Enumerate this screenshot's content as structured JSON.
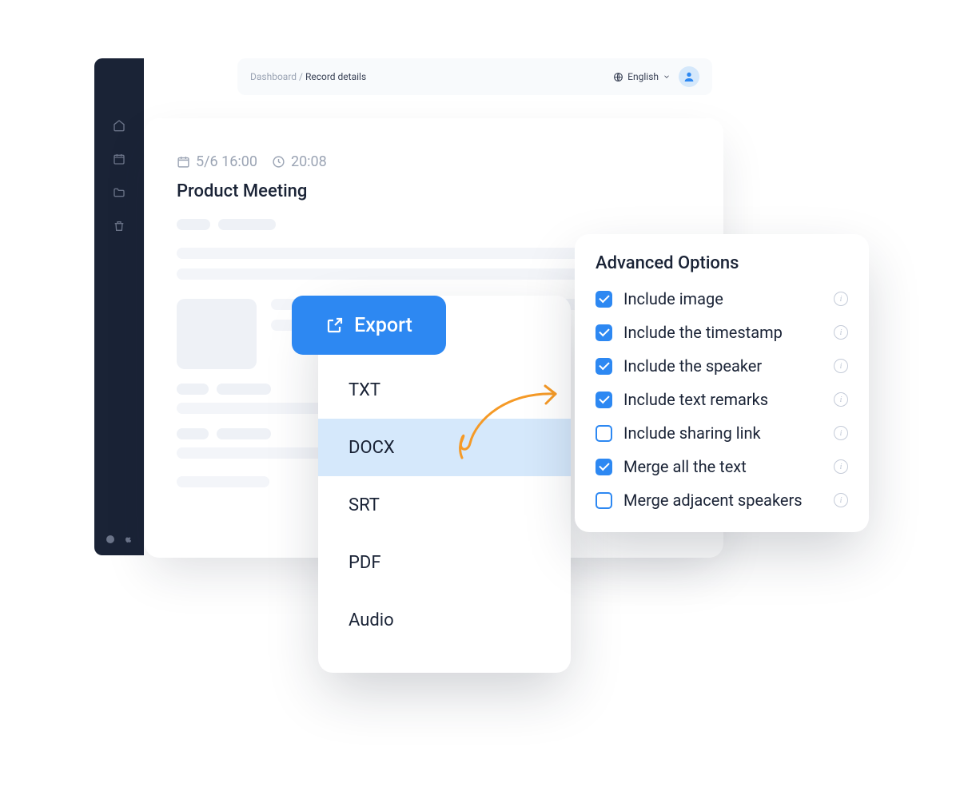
{
  "colors": {
    "accent": "#2d88f2",
    "sidebar": "#1a2336",
    "highlight": "#d5e8fb",
    "arrow": "#f59a27"
  },
  "header": {
    "breadcrumb_root": "Dashboard",
    "breadcrumb_sep": " / ",
    "breadcrumb_current": "Record details",
    "language": "English"
  },
  "record": {
    "date": "5/6 16:00",
    "duration": "20:08",
    "title": "Product Meeting"
  },
  "export": {
    "button_label": "Export",
    "formats": [
      {
        "label": "TXT",
        "highlighted": false
      },
      {
        "label": "DOCX",
        "highlighted": true
      },
      {
        "label": "SRT",
        "highlighted": false
      },
      {
        "label": "PDF",
        "highlighted": false
      },
      {
        "label": "Audio",
        "highlighted": false
      }
    ]
  },
  "options": {
    "title": "Advanced Options",
    "items": [
      {
        "label": "Include image",
        "checked": true
      },
      {
        "label": "Include the timestamp",
        "checked": true
      },
      {
        "label": "Include the speaker",
        "checked": true
      },
      {
        "label": "Include text remarks",
        "checked": true
      },
      {
        "label": "Include sharing link",
        "checked": false
      },
      {
        "label": "Merge all the text",
        "checked": true
      },
      {
        "label": "Merge adjacent speakers",
        "checked": false
      }
    ]
  }
}
